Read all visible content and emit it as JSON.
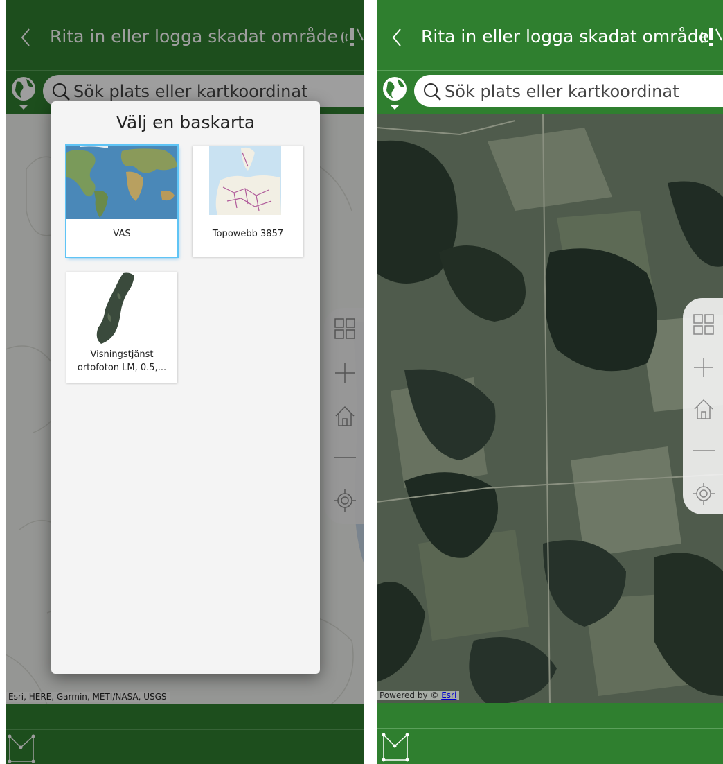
{
  "left_screen": {
    "header": {
      "title": "Rita in eller logga skadat område"
    },
    "search": {
      "placeholder": "Sök plats eller kartkoordinat"
    },
    "attribution": "Esri, HERE, Garmin, METI/NASA, USGS",
    "basemap_gallery": {
      "title": "Välj en baskarta",
      "items": [
        {
          "label": "VAS",
          "selected": true
        },
        {
          "label": "Topowebb 3857",
          "selected": false
        },
        {
          "label_line1": "Visningstjänst",
          "label_line2": "ortofoton LM, 0.5,...",
          "selected": false
        }
      ]
    }
  },
  "right_screen": {
    "header": {
      "title": "Rita in eller logga skadat område"
    },
    "search": {
      "placeholder": "Sök plats eller kartkoordinat"
    },
    "attribution": {
      "prefix": "Powered by © ",
      "link": "Esri"
    }
  },
  "icons": {
    "back": "chevron-left-icon",
    "title_action": "pin-signal-icon",
    "basemap_toggle": "globe-icon",
    "search": "search-icon",
    "zoom_controls": [
      "basemap-grid-icon",
      "plus-icon",
      "home-icon",
      "minus-icon",
      "locate-icon"
    ],
    "draw": "draw-polygon-icon"
  },
  "colors": {
    "header_green": "#2f7f2f",
    "selected_outline": "#5fc4f5",
    "gallery_background": "#f4f4f4"
  }
}
